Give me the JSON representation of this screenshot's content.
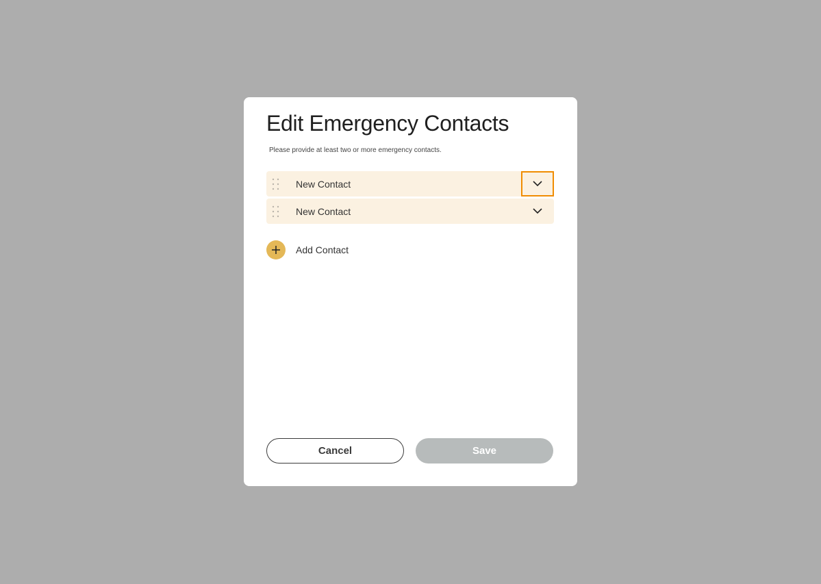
{
  "modal": {
    "title": "Edit Emergency Contacts",
    "subtitle": "Please provide at least two or more emergency contacts."
  },
  "contacts": [
    {
      "name": "New Contact"
    },
    {
      "name": "New Contact"
    }
  ],
  "add_contact": {
    "label": "Add Contact"
  },
  "actions": {
    "cancel_label": "Cancel",
    "save_label": "Save"
  },
  "colors": {
    "overlay": "#adadad",
    "row_bg": "#fbf1e1",
    "accent": "#e4b857",
    "focus": "#f08c00",
    "save_disabled": "#b7bbbb"
  },
  "icons": {
    "drag": "drag-handle-icon",
    "expand": "chevron-down-icon",
    "add": "plus-icon"
  }
}
